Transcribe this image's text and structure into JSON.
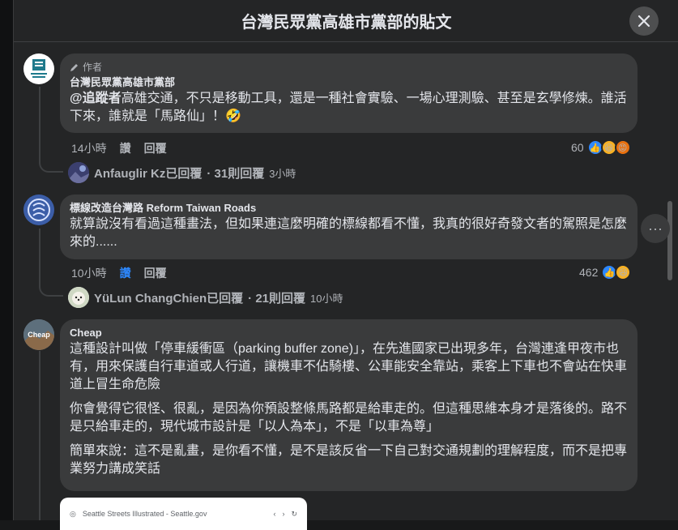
{
  "modal": {
    "title": "台灣民眾黨高雄市黨部的貼文"
  },
  "comments": [
    {
      "author_tag": "作者",
      "name": "台灣民眾黨高雄市黨部",
      "mention": "@追蹤者",
      "text": "高雄交通，不只是移動工具，還是一種社會實驗、一場心理測驗、甚至是玄學修煉。誰活下來，誰就是「馬路仙」！🤣",
      "time": "14小時",
      "like": "讚",
      "reply": "回覆",
      "reaction_count": "60",
      "reply_summary": {
        "who": "Anfauglir Kz已回覆",
        "count": "· 31則回覆",
        "ago": "3小時"
      }
    },
    {
      "name": "標線改造台灣路 Reform Taiwan Roads",
      "text": "就算說沒有看過這種畫法，但如果連這麼明確的標線都看不懂，我真的很好奇發文者的駕照是怎麼來的......",
      "time": "10小時",
      "like": "讚",
      "reply": "回覆",
      "reaction_count": "462",
      "reply_summary": {
        "who": "YüLun ChangChien已回覆",
        "count": "· 21則回覆",
        "ago": "10小時"
      }
    },
    {
      "name": "Cheap",
      "avatar_text": "Cheap",
      "paragraphs": [
        "這種設計叫做「停車緩衝區（parking buffer zone)」，在先進國家已出現多年，台灣連逢甲夜市也有，用來保護自行車道或人行道，讓機車不佔騎樓、公車能安全靠站，乘客上下車也不會站在快車道上冒生命危險",
        "你會覺得它很怪、很亂，是因為你預設整條馬路都是給車走的。但這種思維本身才是落後的。路不是只給車走的，現代城市設計是「以人為本」，不是「以車為尊」",
        "簡單來說：這不是亂畫，是你看不懂，是不是該反省一下自己對交通規劃的理解程度，而不是把專業努力講成笑話"
      ]
    }
  ],
  "preview": {
    "url": "Seattle Streets Illustrated - Seattle.gov"
  },
  "colors": {
    "bg": "#242526",
    "bubble": "#3a3b3c",
    "like_blue": "#2d88ff"
  }
}
